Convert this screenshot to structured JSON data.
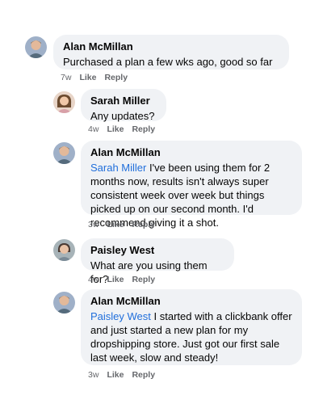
{
  "comments": [
    {
      "author": "Alan McMillan",
      "mention": "",
      "text": "Purchased a plan a few wks ago, good so far",
      "time": "7w",
      "like": "Like",
      "reply": "Reply",
      "avatar": "alan-avatar"
    },
    {
      "author": "Sarah Miller",
      "mention": "",
      "text": "Any updates?",
      "time": "4w",
      "like": "Like",
      "reply": "Reply",
      "avatar": "sarah-avatar"
    },
    {
      "author": "Alan McMillan",
      "mention": "Sarah Miller",
      "text": "I've been using them for 2 months now, results isn't always super consistent week over week but things picked up on our second month. I'd recommend giving it a shot.",
      "time": "3w",
      "like": "Like",
      "reply": "Reply",
      "avatar": "alan-avatar"
    },
    {
      "author": "Paisley West",
      "mention": "",
      "text": "What are you using them for?",
      "time": "4w",
      "like": "Like",
      "reply": "Reply",
      "avatar": "paisley-avatar"
    },
    {
      "author": "Alan McMillan",
      "mention": "Paisley West",
      "text": "I started with a clickbank offer and just started a new plan for my dropshipping store. Just got our first sale last week, slow and steady!",
      "time": "3w",
      "like": "Like",
      "reply": "Reply",
      "avatar": "alan-avatar"
    }
  ],
  "colors": {
    "bubble": "#f0f2f5",
    "mention": "#216fdb",
    "meta": "#65676b"
  }
}
